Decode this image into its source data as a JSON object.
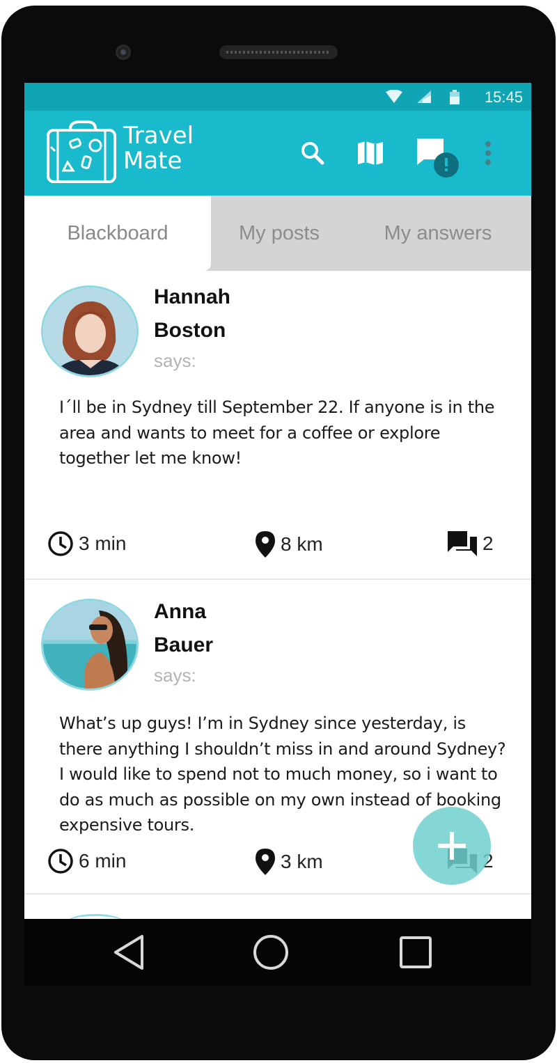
{
  "status_bar": {
    "time": "15:45"
  },
  "app": {
    "name_line1": "Travel",
    "name_line2": "Mate"
  },
  "actions": {
    "search": "search-icon",
    "map": "map-icon",
    "messages": "chat-alert-icon",
    "more": "more-vert-icon",
    "message_badge": "!"
  },
  "tabs": [
    {
      "label": "Blackboard",
      "active": true
    },
    {
      "label": "My posts",
      "active": false
    },
    {
      "label": "My answers",
      "active": false
    }
  ],
  "posts": [
    {
      "first_name": "Hannah",
      "last_name": "Boston",
      "says": "says:",
      "text": "I´ll be in Sydney till September 22. If anyone is in the area and wants to meet for a coffee or explore together let me know!",
      "time": "3 min",
      "distance": "8 km",
      "answers": "2"
    },
    {
      "first_name": "Anna",
      "last_name": "Bauer",
      "says": "says:",
      "text": "What’s up guys! I’m in Sydney since yesterday, is there anything I shouldn’t miss in and around Sydney? I would like to spend not to much money, so i want to do as much as possible on my own instead of booking expensive tours.",
      "time": "6 min",
      "distance": "3 km",
      "answers": "2"
    }
  ],
  "fab": {
    "icon": "plus-icon"
  },
  "colors": {
    "status_bar": "#10a5b4",
    "app_bar": "#19bacc",
    "fab": "#6ed0cc",
    "tab_bg": "#d4d4d4"
  }
}
